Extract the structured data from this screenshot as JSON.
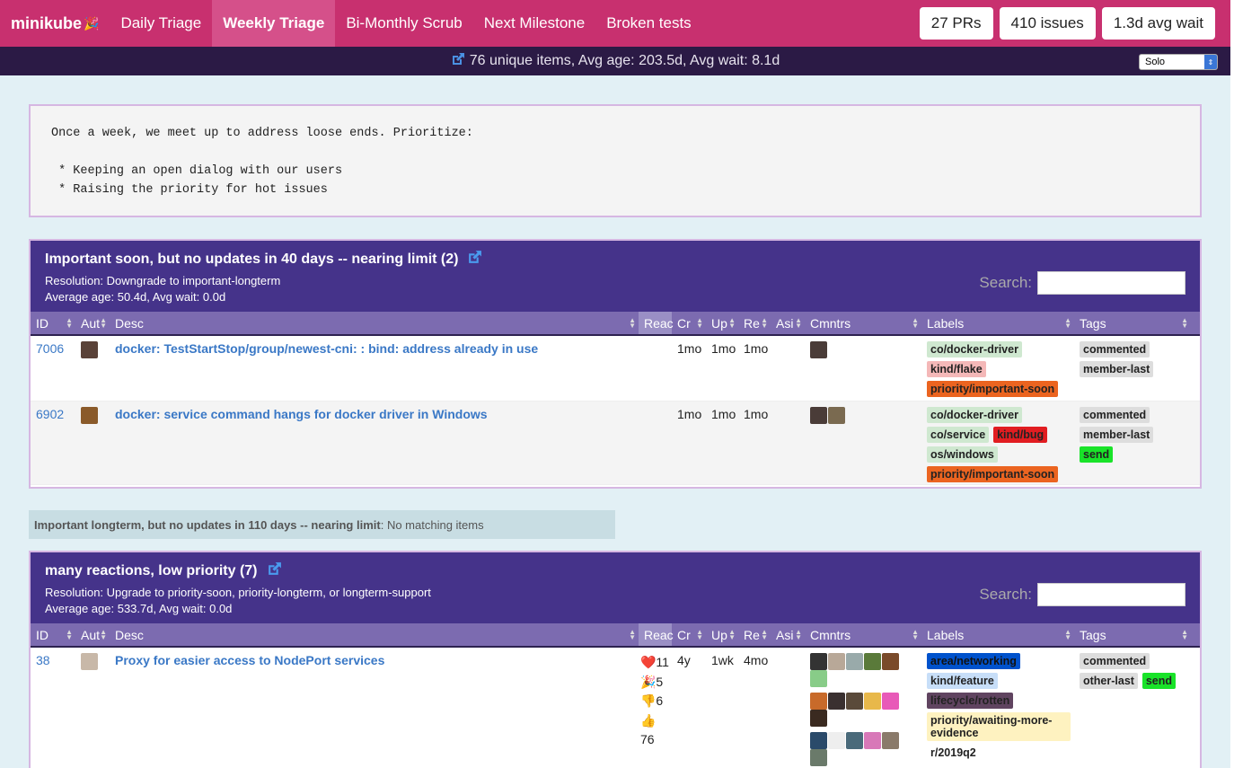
{
  "brand": {
    "name": "minikube",
    "logo_icon": "party-popper-icon"
  },
  "nav": [
    {
      "label": "Daily Triage",
      "active": false
    },
    {
      "label": "Weekly Triage",
      "active": true
    },
    {
      "label": "Bi-Monthly Scrub",
      "active": false
    },
    {
      "label": "Next Milestone",
      "active": false
    },
    {
      "label": "Broken tests",
      "active": false
    }
  ],
  "stats": {
    "prs": "27 PRs",
    "issues": "410 issues",
    "wait": "1.3d avg wait"
  },
  "subbar": {
    "summary": "76 unique items, Avg age: 203.5d, Avg wait: 8.1d",
    "player_select": "Solo"
  },
  "description": "Once a week, we meet up to address loose ends. Prioritize:\n\n * Keeping an open dialog with our users\n * Raising the priority for hot issues",
  "columns": [
    "ID",
    "Aut",
    "Desc",
    "Reac",
    "Cr",
    "Up",
    "Re",
    "Asi",
    "Cmntrs",
    "Labels",
    "Tags"
  ],
  "search_label": "Search:",
  "sections": [
    {
      "title": "Important soon, but no updates in 40 days -- nearing limit (2)",
      "resolution": "Resolution: Downgrade to important-longterm",
      "averages": "Average age: 50.4d, Avg wait: 0.0d",
      "rows": [
        {
          "id": "7006",
          "title": "docker: TestStartStop/group/newest-cni: : bind: address already in use",
          "reactions": [],
          "created": "1mo",
          "updated": "1mo",
          "responded": "1mo",
          "labels": [
            {
              "text": "co/docker-driver",
              "color": "#cfe8d0"
            },
            {
              "text": "kind/flake",
              "color": "#f4b8b8"
            },
            {
              "text": "priority/important-soon",
              "color": "#eb6420"
            }
          ],
          "tags": [
            {
              "text": "commented",
              "send": false
            },
            {
              "text": "member-last",
              "send": false
            }
          ]
        },
        {
          "id": "6902",
          "title": "docker: service command hangs for docker driver in Windows",
          "reactions": [],
          "created": "1mo",
          "updated": "1mo",
          "responded": "1mo",
          "labels": [
            {
              "text": "co/docker-driver",
              "color": "#cfe8d0"
            },
            {
              "text": "co/service",
              "color": "#cfe8d0"
            },
            {
              "text": "kind/bug",
              "color": "#e11d21"
            },
            {
              "text": "os/windows",
              "color": "#cfe8d0"
            },
            {
              "text": "priority/important-soon",
              "color": "#eb6420"
            }
          ],
          "tags": [
            {
              "text": "commented",
              "send": false
            },
            {
              "text": "member-last",
              "send": false
            },
            {
              "text": "send",
              "send": true
            }
          ]
        }
      ]
    },
    {
      "title": "Important longterm, but no updates in 110 days -- nearing limit",
      "nomatch": ": No matching items"
    },
    {
      "title": "many reactions, low priority (7)",
      "resolution": "Resolution: Upgrade to priority-soon, priority-longterm, or longterm-support",
      "averages": "Average age: 533.7d, Avg wait: 0.0d",
      "rows": [
        {
          "id": "38",
          "title": "Proxy for easier access to NodePort services",
          "created": "4y",
          "updated": "1wk",
          "responded": "4mo",
          "reactions": [
            "❤️11",
            "🎉5",
            "👎6",
            "👍",
            "76"
          ],
          "labels": [
            {
              "text": "area/networking",
              "color": "#0052cc"
            },
            {
              "text": "kind/feature",
              "color": "#c7def8"
            },
            {
              "text": "lifecycle/rotten",
              "color": "#604460"
            },
            {
              "text": "priority/awaiting-more-evidence",
              "color": "#fef2c0"
            },
            {
              "text": "r/2019q2",
              "color": "#ffffff"
            }
          ],
          "tags": [
            {
              "text": "commented",
              "send": false
            },
            {
              "text": "other-last",
              "send": false
            },
            {
              "text": "send",
              "send": true
            }
          ]
        }
      ]
    }
  ]
}
